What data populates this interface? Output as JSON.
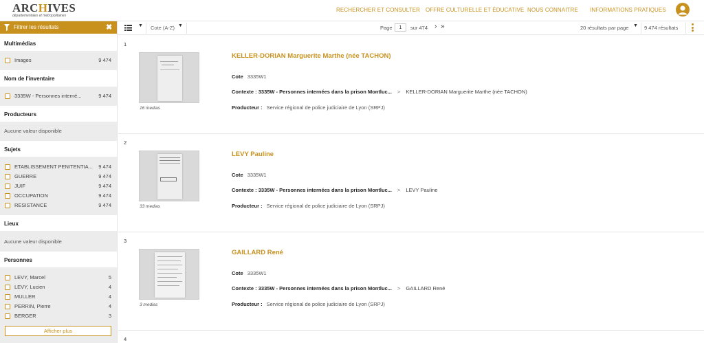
{
  "header": {
    "logo_main_prefix": "ARC",
    "logo_main_accent": "H",
    "logo_main_suffix": "IVES",
    "logo_sub": "départementales et métropolitaines",
    "nav": [
      "RECHERCHER ET CONSULTER",
      "OFFRE CULTURELLE ET ÉDUCATIVE",
      "NOUS CONNAITRE",
      "INFORMATIONS PRATIQUES"
    ]
  },
  "sidebar": {
    "filter_label": "Filtrer les résultats",
    "sections": {
      "multimedia": {
        "title": "Multimédias",
        "items": [
          {
            "name": "Images",
            "count": "9 474"
          }
        ]
      },
      "inventory": {
        "title": "Nom de l'inventaire",
        "items": [
          {
            "name": "3335W - Personnes interné...",
            "count": "9 474"
          }
        ]
      },
      "producers": {
        "title": "Producteurs",
        "empty": "Aucune valeur disponible"
      },
      "subjects": {
        "title": "Sujets",
        "items": [
          {
            "name": "ETABLISSEMENT PENITENTIA...",
            "count": "9 474"
          },
          {
            "name": "GUERRE",
            "count": "9 474"
          },
          {
            "name": "JUIF",
            "count": "9 474"
          },
          {
            "name": "OCCUPATION",
            "count": "9 474"
          },
          {
            "name": "RESISTANCE",
            "count": "9 474"
          }
        ]
      },
      "places": {
        "title": "Lieux",
        "empty": "Aucune valeur disponible"
      },
      "persons": {
        "title": "Personnes",
        "items": [
          {
            "name": "LEVY, Marcel",
            "count": "5"
          },
          {
            "name": "LEVY, Lucien",
            "count": "4"
          },
          {
            "name": "MULLER",
            "count": "4"
          },
          {
            "name": "PERRIN, Pierre",
            "count": "4"
          },
          {
            "name": "BERGER",
            "count": "3"
          }
        ]
      }
    },
    "show_more": "Afficher plus"
  },
  "toolbar": {
    "sort": "Cote (A-Z)",
    "page_label": "Page",
    "page_value": "1",
    "page_of": "sur 474",
    "per_page": "20 résultats par page",
    "total": "9 474 résultats"
  },
  "labels": {
    "cote": "Cote",
    "context": "Contexte : 3335W - Personnes internées dans la prison Montluc...",
    "producer": "Producteur :"
  },
  "results": [
    {
      "num": "1",
      "title": "KELLER-DORIAN Marguerite Marthe (née TACHON)",
      "cote": "3335W1",
      "context_leaf": "KELLER-DORIAN Marguerite Marthe (née TACHON)",
      "producer": "Service régional de police judiciaire de Lyon (SRPJ)",
      "medias": "16 medias"
    },
    {
      "num": "2",
      "title": "LEVY Pauline",
      "cote": "3335W1",
      "context_leaf": "LEVY Pauline",
      "producer": "Service régional de police judiciaire de Lyon (SRPJ)",
      "medias": "33 medias"
    },
    {
      "num": "3",
      "title": "GAILLARD René",
      "cote": "3335W1",
      "context_leaf": "GAILLARD René",
      "producer": "Service régional de police judiciaire de Lyon (SRPJ)",
      "medias": "3 medias"
    },
    {
      "num": "4"
    }
  ]
}
